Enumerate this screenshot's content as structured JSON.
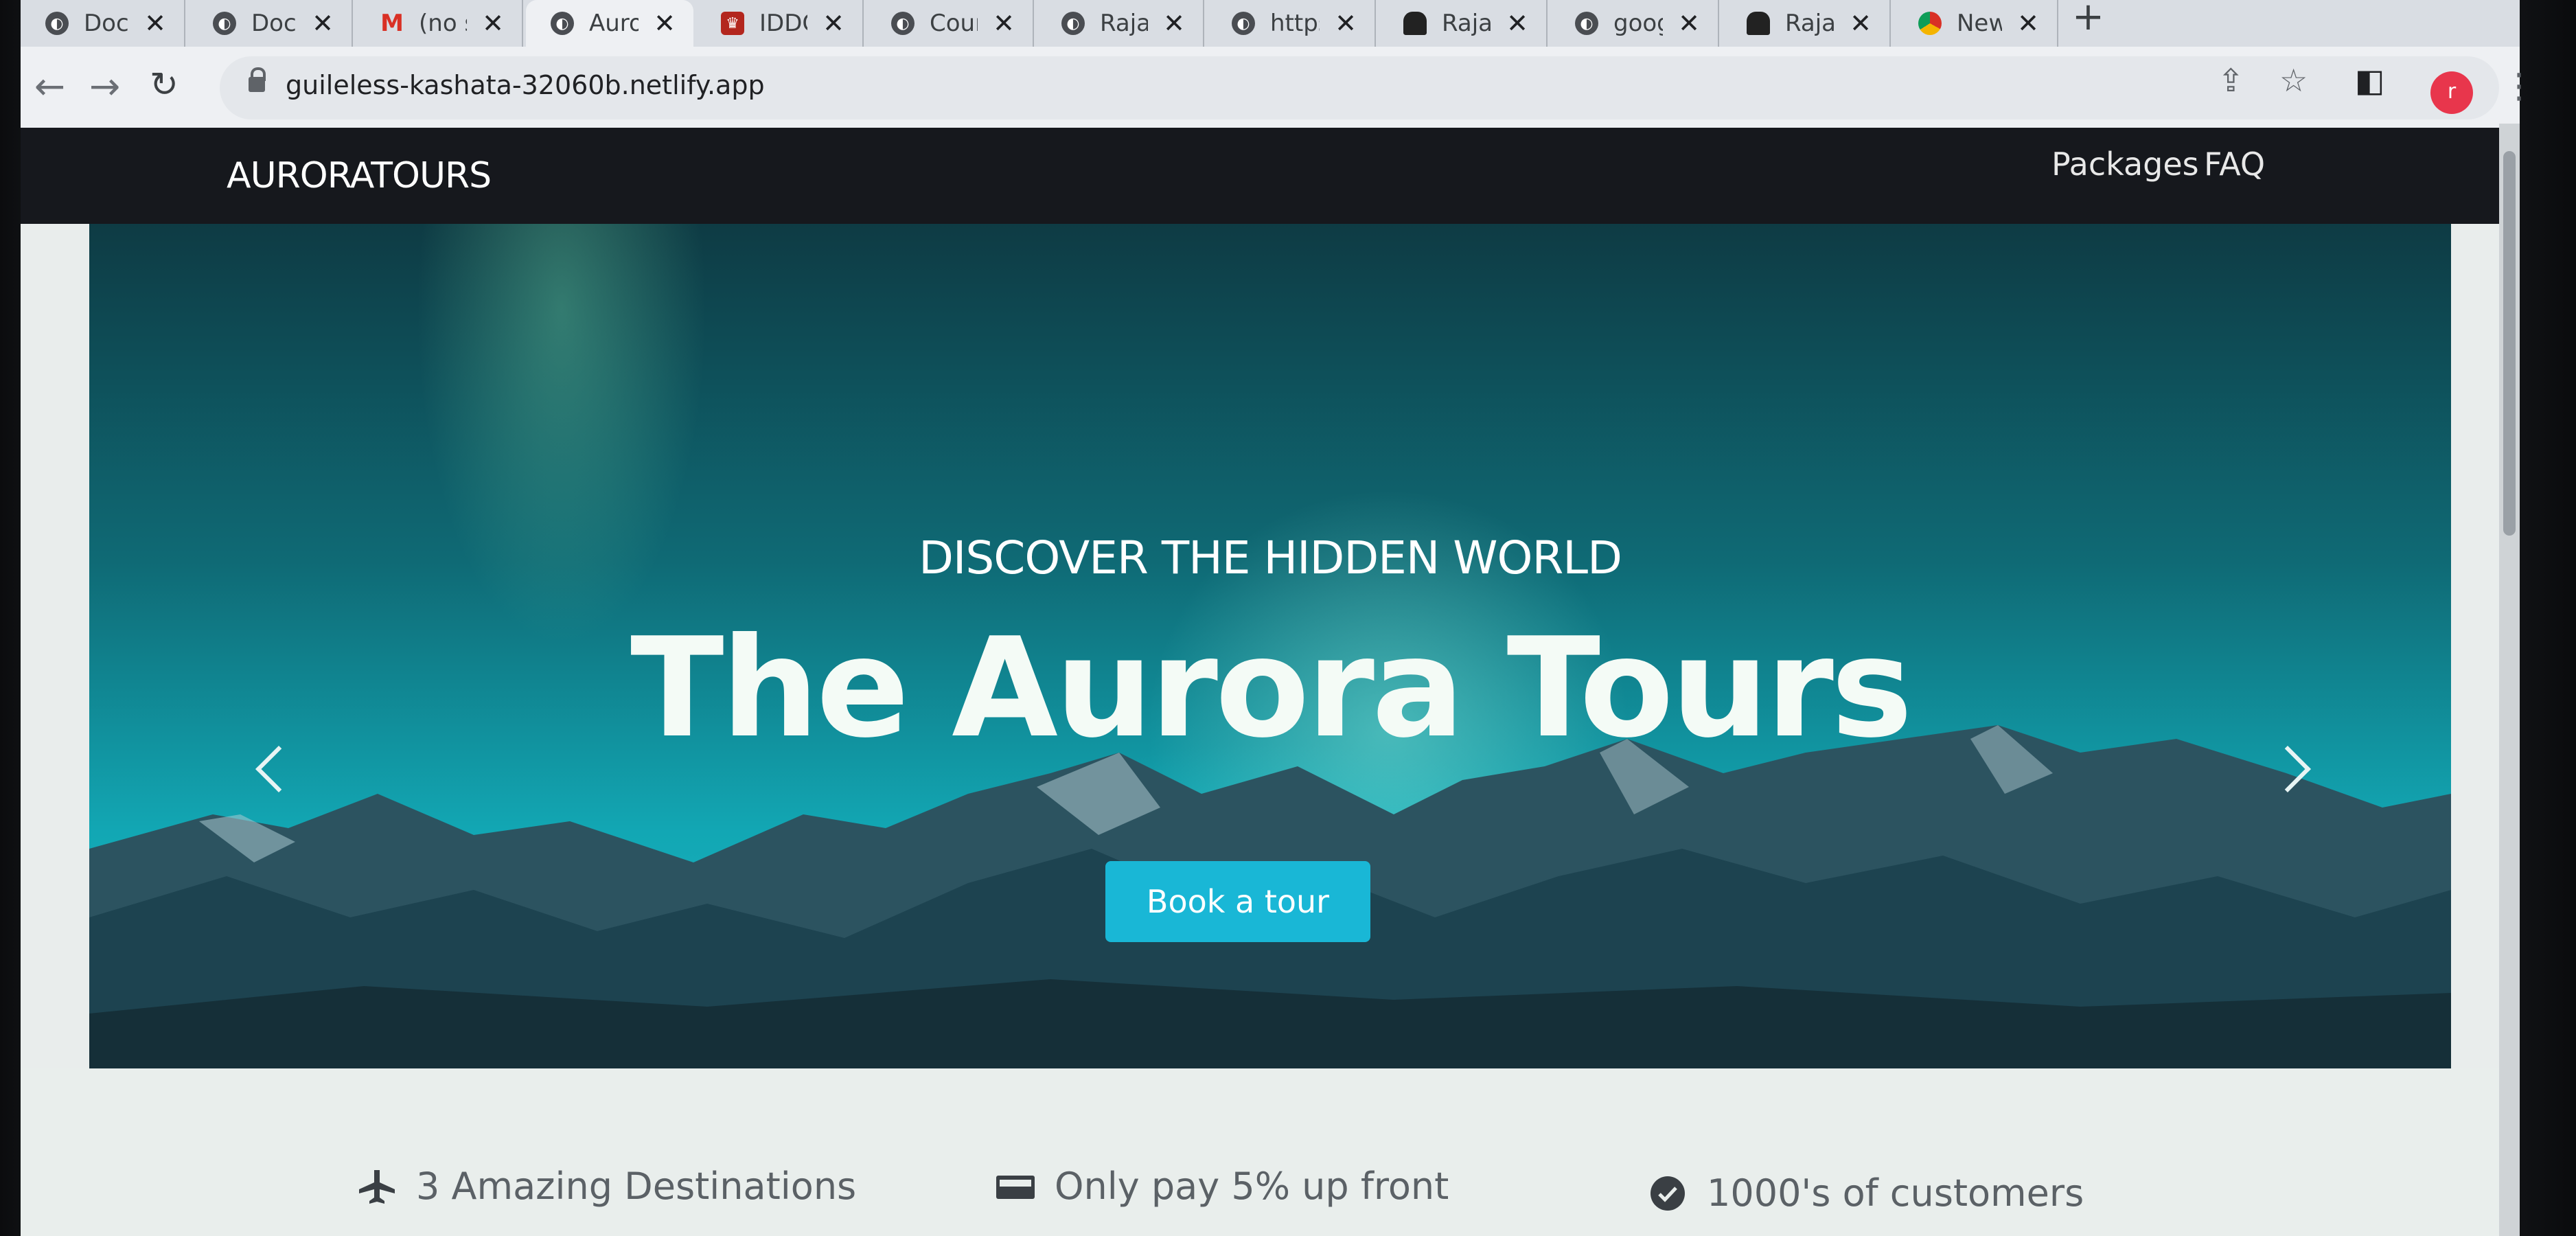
{
  "browser": {
    "tabs": [
      {
        "title": "Docu",
        "icon": "globe-icon"
      },
      {
        "title": "Docu",
        "icon": "globe-icon"
      },
      {
        "title": "(no s",
        "icon": "gmail-icon"
      },
      {
        "title": "Auro",
        "icon": "globe-icon",
        "active": true
      },
      {
        "title": "IDDC",
        "icon": "idd-icon"
      },
      {
        "title": "Cour",
        "icon": "globe-icon"
      },
      {
        "title": "Rajat",
        "icon": "globe-icon"
      },
      {
        "title": "https",
        "icon": "globe-icon"
      },
      {
        "title": "Rajat",
        "icon": "person-icon"
      },
      {
        "title": "goog",
        "icon": "globe-icon"
      },
      {
        "title": "Rajat",
        "icon": "person-icon"
      },
      {
        "title": "New",
        "icon": "chrome-icon"
      }
    ],
    "new_tab_glyph": "+",
    "close_glyph": "✕",
    "url": "guileless-kashata-32060b.netlify.app",
    "profile_initial": "r",
    "icons": [
      "back-icon",
      "forward-icon",
      "reload-icon",
      "lock-icon",
      "share-icon",
      "star-icon",
      "sidepanel-icon",
      "menu-icon"
    ]
  },
  "site": {
    "brand": "AURORATOURS",
    "nav": {
      "packages": "Packages",
      "faq": "FAQ"
    },
    "hero": {
      "subtitle": "DISCOVER THE HIDDEN WORLD",
      "title": "The Aurora Tours",
      "cta": "Book a tour"
    },
    "features": [
      {
        "icon": "airplane-icon",
        "label": "3 Amazing Destinations"
      },
      {
        "icon": "money-icon",
        "label": "Only pay 5% up front"
      },
      {
        "icon": "verified-badge-icon",
        "label": "1000's of customers"
      }
    ]
  },
  "colors": {
    "nav_bg": "#16181d",
    "cta_bg": "#19b7d6",
    "hero_teal": "#12a7b4",
    "feature_text": "#5b6166"
  }
}
